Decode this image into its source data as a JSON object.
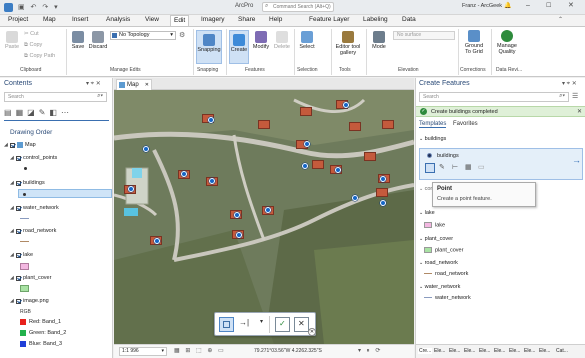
{
  "titlebar": {
    "app": "ArcPro",
    "search_placeholder": "Command Search (Alt+Q)",
    "user": "Franz - ArcGeek"
  },
  "ribbon_tabs": [
    "Project",
    "Map",
    "Insert",
    "Analysis",
    "View",
    "Edit",
    "Imagery",
    "Share",
    "Help",
    "Feature Layer",
    "Labeling",
    "Data"
  ],
  "active_tab": "Edit",
  "clipboard": {
    "paste": "Paste",
    "cut": "Cut",
    "copy": "Copy",
    "copy_path": "Copy Path",
    "group": "Clipboard"
  },
  "manage_edits": {
    "save": "Save",
    "discard": "Discard",
    "topology": "No Topology",
    "group": "Manage Edits"
  },
  "snapping": {
    "label": "Snapping",
    "group": "Snapping"
  },
  "features": {
    "create": "Create",
    "modify": "Modify",
    "delete": "Delete",
    "group": "Features"
  },
  "selection": {
    "select": "Select",
    "group": "Selection"
  },
  "tools": {
    "gallery": "Editor tool gallery",
    "group": "Tools"
  },
  "elevation": {
    "mode": "Mode",
    "surface": "No surface",
    "group": "Elevation"
  },
  "corrections": {
    "ground": "Ground To Grid",
    "group": "Corrections"
  },
  "data_reviewer": {
    "manage": "Manage Quality",
    "group": "Data Revi..."
  },
  "contents": {
    "title": "Contents",
    "search_placeholder": "Search",
    "drawing_order": "Drawing Order",
    "layers": [
      {
        "name": "Map"
      },
      {
        "name": "control_points"
      },
      {
        "name": "buildings"
      },
      {
        "name": "water_network"
      },
      {
        "name": "road_network"
      },
      {
        "name": "lake"
      },
      {
        "name": "plant_cover"
      },
      {
        "name": "image.png"
      }
    ],
    "rgb_label": "RGB",
    "bands": [
      {
        "label": "Red: Band_1",
        "color": "#e8201c"
      },
      {
        "label": "Green: Band_2",
        "color": "#22b14c"
      },
      {
        "label": "Blue: Band_3",
        "color": "#1f3fd8"
      }
    ]
  },
  "map": {
    "tab": "Map",
    "scale": "1:1 996",
    "coords": "79.271°03.56\"W 4.2262.325\"S"
  },
  "create_features": {
    "title": "Create Features",
    "search_placeholder": "Search",
    "status": "Create buildings completed",
    "tab_templates": "Templates",
    "tab_favorites": "Favorites",
    "group_buildings": "buildings",
    "selected_template": "buildings",
    "tooltip_title": "Point",
    "tooltip_text": "Create a point feature.",
    "ghost_label": "control_points",
    "groups": [
      {
        "header": "lake",
        "item": "lake",
        "swatch": "#f3b7e1"
      },
      {
        "header": "plant_cover",
        "item": "plant_cover",
        "swatch": "#a8e2a3"
      },
      {
        "header": "road_network",
        "item": "road_network",
        "swatch": "#b08a66"
      },
      {
        "header": "water_network",
        "item": "water_network",
        "swatch": "#8a9bbf"
      }
    ]
  },
  "bottom_tabs": [
    "Cre...",
    "Ele...",
    "Ele...",
    "Ele...",
    "Ele...",
    "Ele...",
    "Ele...",
    "Ele...",
    "Ele...",
    "Cat..."
  ]
}
